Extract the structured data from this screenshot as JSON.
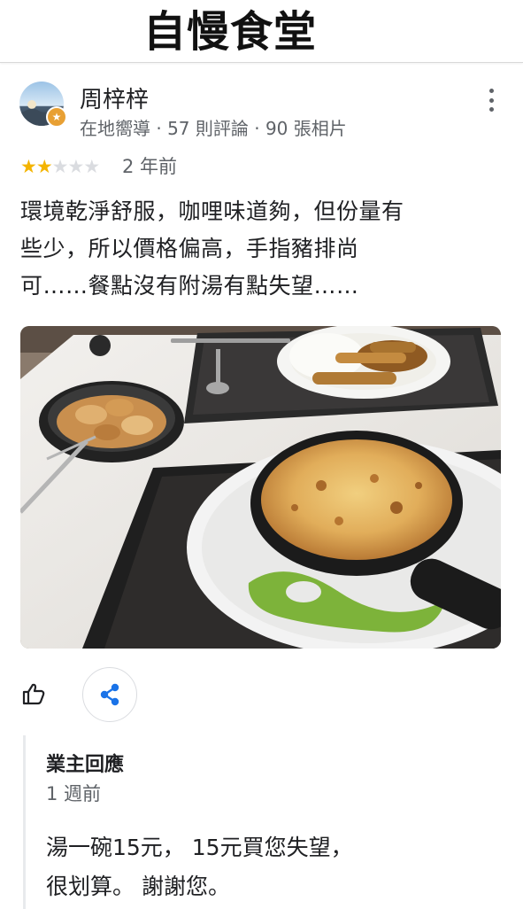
{
  "header": {
    "title": "自慢食堂"
  },
  "review": {
    "reviewer_name": "周梓梓",
    "reviewer_meta": "在地嚮導 · 57 則評論 · 90 張相片",
    "rating": 2,
    "max_rating": 5,
    "time": "2 年前",
    "text_lines": [
      "環境乾淨舒服，咖哩味道夠，但份量有",
      "些少，所以價格偏高，手指豬排尚",
      "可……餐點沒有附湯有點失望……"
    ]
  },
  "owner_response": {
    "title": "業主回應",
    "time": "1 週前",
    "text": "湯一碗15元， 15元買您失望，\n很划算。 謝謝您。"
  },
  "icons": {
    "avatar_badge": "local-guide-star-icon",
    "more": "more-vert-icon",
    "like": "thumb-up-icon",
    "share": "share-icon"
  },
  "colors": {
    "star_filled": "#f4b400",
    "star_empty": "#dadce0",
    "share_icon": "#1a73e8",
    "badge": "#e8a034"
  }
}
